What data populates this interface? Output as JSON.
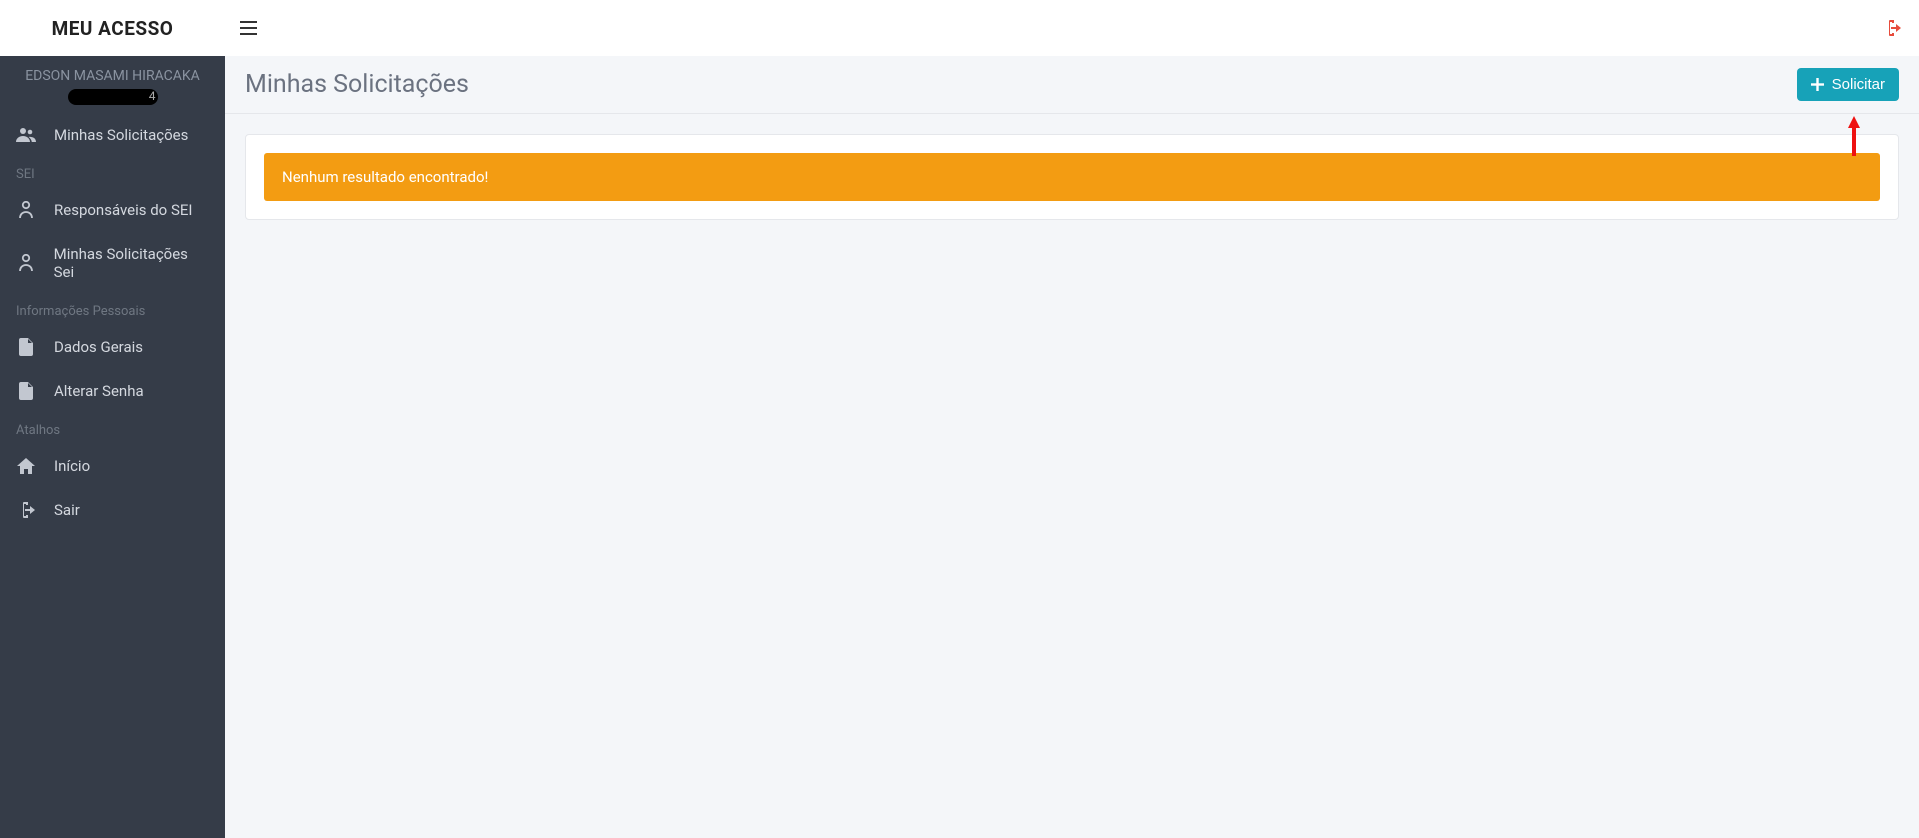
{
  "brand": "MEU ACESSO",
  "user": {
    "name": "EDSON MASAMI HIRACAKA"
  },
  "nav": {
    "minhas_solicitacoes": "Minhas Solicitações",
    "section_sei": "SEI",
    "responsaveis_sei": "Responsáveis do SEI",
    "minhas_solicitacoes_sei": "Minhas Solicitações Sei",
    "section_info": "Informações Pessoais",
    "dados_gerais": "Dados Gerais",
    "alterar_senha": "Alterar Senha",
    "section_atalhos": "Atalhos",
    "inicio": "Início",
    "sair": "Sair"
  },
  "header": {
    "title": "Minhas Solicitações",
    "solicitar_label": "Solicitar"
  },
  "alert": {
    "message": "Nenhum resultado encontrado!"
  }
}
